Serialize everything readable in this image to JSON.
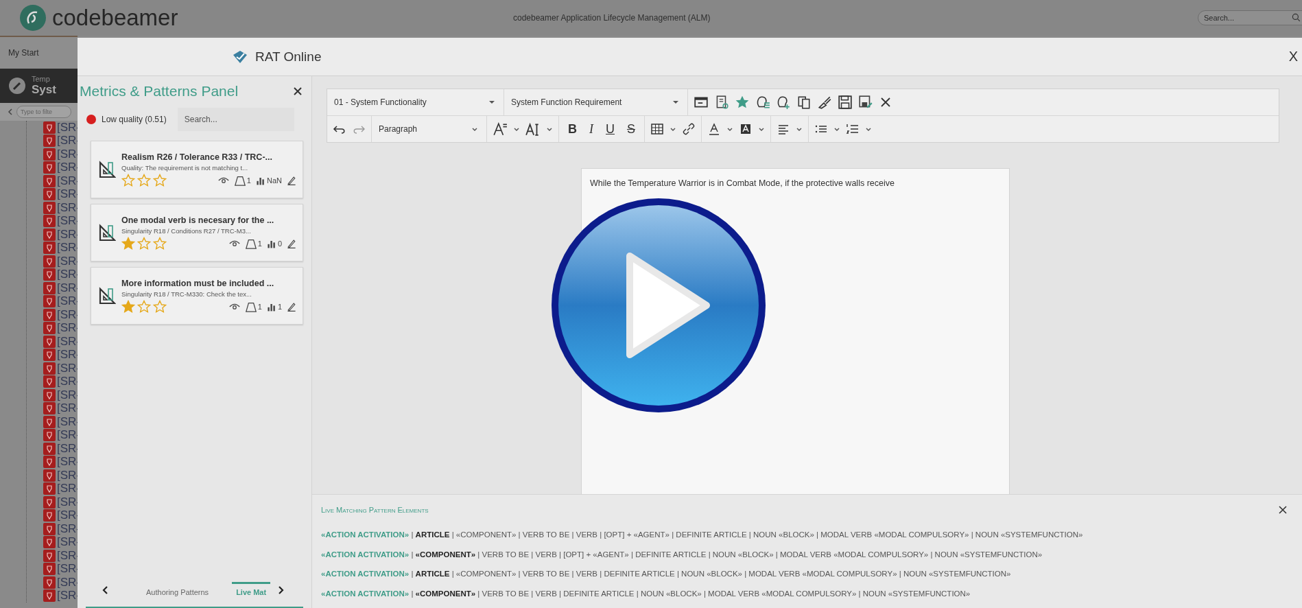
{
  "app_header": {
    "logo": "codebeamer",
    "title": "codebeamer Application Lifecycle Management (ALM)",
    "search": {
      "placeholder": "Search..."
    }
  },
  "background": {
    "nav_tab": "My Start",
    "item_header": {
      "line1": "Temp",
      "line2": "Syst"
    },
    "filter": {
      "placeholder": "Type to filte"
    },
    "tree": {
      "items": [
        "[SR-",
        "[SR-",
        "[SR-",
        "[SR-",
        "[SR-",
        "[SR-",
        "[SR-",
        "[SR-",
        "[SR-",
        "[SR-",
        "[SR-",
        "[SR-",
        "[SR-",
        "[SR-",
        "[SR-",
        "[SR-",
        "[SR-",
        "[SR-",
        "[SR-",
        "[SR-",
        "[SR-",
        "[SR-",
        "[SR-",
        "[SR-",
        "[SR-",
        "[SR-",
        "[SR-",
        "[SR-",
        "[SR-",
        "[SR-",
        "[SR-",
        "[SR-",
        "[SR-",
        "[SR-",
        "[SR-",
        "[SR-"
      ]
    }
  },
  "dialog": {
    "title": "RAT Online",
    "close": "X"
  },
  "metrics_panel": {
    "title": "Metrics & Patterns Panel",
    "quality": {
      "label": "Low quality (0.51)",
      "color": "#d61f1f"
    },
    "search": {
      "placeholder": "Search..."
    },
    "cards": [
      {
        "title": "Realism R26 / Tolerance R33 / TRC-...",
        "subtitle": "Quality: The requirement is not matching t...",
        "stars": 0,
        "weight": "1",
        "score": "NaN"
      },
      {
        "title": "One modal verb is necesary for the ...",
        "subtitle": "Singularity R18 / Conditions R27 / TRC-M3...",
        "stars": 1,
        "weight": "1",
        "score": "0"
      },
      {
        "title": "More information must be included ...",
        "subtitle": "Singularity R18 / TRC-M330: Check the tex...",
        "stars": 1,
        "weight": "1",
        "score": "1"
      }
    ],
    "tabs": [
      {
        "label": "Authoring Patterns",
        "selected": false
      },
      {
        "label": "Live Mat",
        "selected": true
      }
    ]
  },
  "editor": {
    "selects": [
      "01 - System Functionality",
      "System Function Requirement"
    ],
    "paragraph_style": "Paragraph",
    "format_buttons": [
      {
        "label": "B",
        "kind": "bold"
      },
      {
        "label": "I",
        "kind": "italic"
      },
      {
        "label": "U",
        "kind": "underline"
      },
      {
        "label": "S",
        "kind": "strike"
      }
    ],
    "text": "While the Temperature Warrior is in Combat Mode, if the protective walls receive"
  },
  "pattern_panel": {
    "title": "Live Matching Pattern Elements",
    "lines": [
      [
        {
          "text": "«ACTION ACTIVATION»",
          "kind": "tag"
        },
        {
          "text": " | ",
          "kind": "plain"
        },
        {
          "text": "ARTICLE",
          "kind": "bold"
        },
        {
          "text": " | «COMPONENT» | VERB TO BE | VERB | [OPT] + «AGENT» | DEFINITE ARTICLE | NOUN «BLOCK» | MODAL VERB «MODAL COMPULSORY» | NOUN «SYSTEMFUNCTION»",
          "kind": "plain"
        }
      ],
      [
        {
          "text": "«ACTION ACTIVATION»",
          "kind": "tag"
        },
        {
          "text": " | ",
          "kind": "plain"
        },
        {
          "text": "«COMPONENT»",
          "kind": "bold"
        },
        {
          "text": " | VERB TO BE | VERB | [OPT] + «AGENT» | DEFINITE ARTICLE | NOUN «BLOCK» | MODAL VERB «MODAL COMPULSORY» | NOUN «SYSTEMFUNCTION»",
          "kind": "plain"
        }
      ],
      [
        {
          "text": "«ACTION ACTIVATION»",
          "kind": "tag"
        },
        {
          "text": " | ",
          "kind": "plain"
        },
        {
          "text": "ARTICLE",
          "kind": "bold"
        },
        {
          "text": " | «COMPONENT» | VERB TO BE | VERB | DEFINITE ARTICLE | NOUN «BLOCK» | MODAL VERB «MODAL COMPULSORY» | NOUN «SYSTEMFUNCTION»",
          "kind": "plain"
        }
      ],
      [
        {
          "text": "«ACTION ACTIVATION»",
          "kind": "tag"
        },
        {
          "text": " | ",
          "kind": "plain"
        },
        {
          "text": "«COMPONENT»",
          "kind": "bold"
        },
        {
          "text": " | VERB TO BE | VERB | DEFINITE ARTICLE | NOUN «BLOCK» | MODAL VERB «MODAL COMPULSORY» | NOUN «SYSTEMFUNCTION»",
          "kind": "plain"
        }
      ]
    ]
  }
}
